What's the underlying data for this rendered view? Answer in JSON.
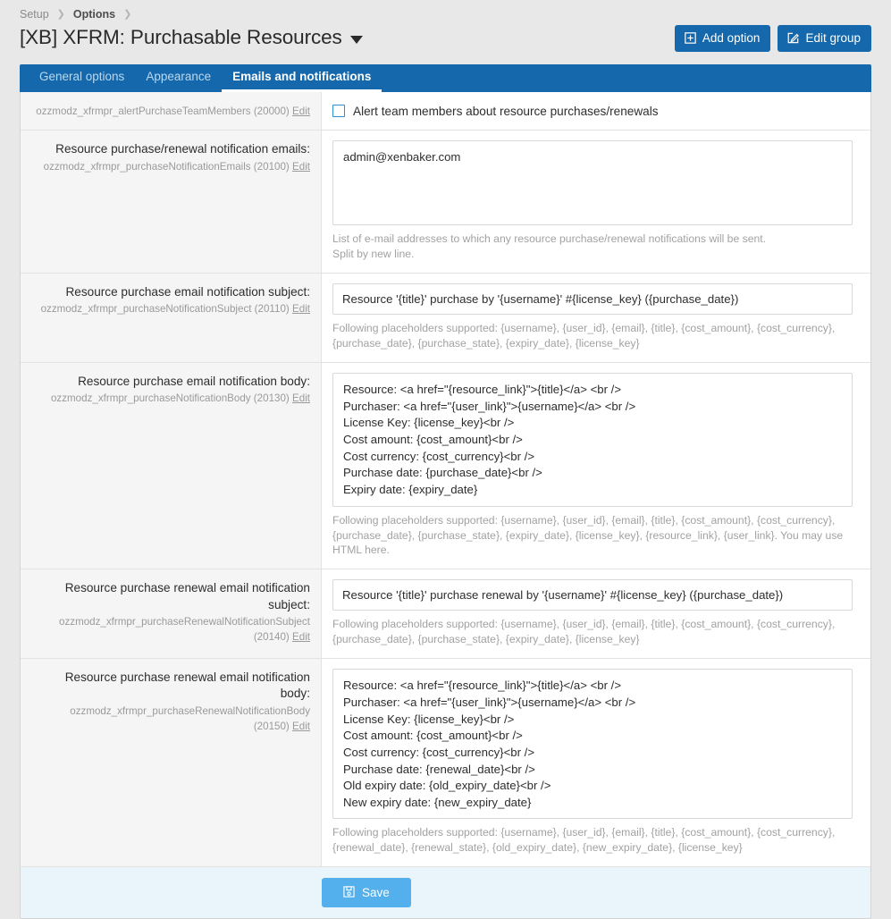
{
  "breadcrumb": [
    {
      "label": "Setup",
      "strong": false
    },
    {
      "label": "Options",
      "strong": true
    }
  ],
  "header": {
    "title": "[XB] XFRM: Purchasable Resources",
    "caret_icon": "chevron-down-icon",
    "buttons": [
      {
        "label": "Add option",
        "icon": "plus-box-icon"
      },
      {
        "label": "Edit group",
        "icon": "pencil-square-icon"
      }
    ]
  },
  "tabs": [
    {
      "label": "General options",
      "active": false
    },
    {
      "label": "Appearance",
      "active": false
    },
    {
      "label": "Emails and notifications",
      "active": true
    }
  ],
  "rows": {
    "alert_team": {
      "option_id": "ozzmodz_xfrmpr_alertPurchaseTeamMembers (20000)",
      "edit_label": "Edit",
      "checkbox_label": "Alert team members about resource purchases/renewals",
      "checked": false
    },
    "notification_emails": {
      "label": "Resource purchase/renewal notification emails:",
      "option_id": "ozzmodz_xfrmpr_purchaseNotificationEmails (20100)",
      "edit_label": "Edit",
      "value": "admin@xenbaker.com",
      "hint": "List of e-mail addresses to which any resource purchase/renewal notifications will be sent.\nSplit by new line."
    },
    "purchase_subject": {
      "label": "Resource purchase email notification subject:",
      "option_id": "ozzmodz_xfrmpr_purchaseNotificationSubject (20110)",
      "edit_label": "Edit",
      "value": "Resource '{title}' purchase by '{username}' #{license_key} ({purchase_date})",
      "hint": "Following placeholders supported: {username}, {user_id}, {email}, {title}, {cost_amount}, {cost_currency}, {purchase_date}, {purchase_state}, {expiry_date}, {license_key}"
    },
    "purchase_body": {
      "label": "Resource purchase email notification body:",
      "option_id": "ozzmodz_xfrmpr_purchaseNotificationBody (20130)",
      "edit_label": "Edit",
      "value": "Resource: <a href=\"{resource_link}\">{title}</a> <br />\nPurchaser: <a href=\"{user_link}\">{username}</a> <br />\nLicense Key: {license_key}<br />\nCost amount: {cost_amount}<br />\nCost currency: {cost_currency}<br />\nPurchase date: {purchase_date}<br />\nExpiry date: {expiry_date}",
      "hint": "Following placeholders supported: {username}, {user_id}, {email}, {title}, {cost_amount}, {cost_currency}, {purchase_date}, {purchase_state}, {expiry_date}, {license_key}, {resource_link}, {user_link}. You may use HTML here."
    },
    "renewal_subject": {
      "label": "Resource purchase renewal email notification subject:",
      "option_id": "ozzmodz_xfrmpr_purchaseRenewalNotificationSubject (20140)",
      "edit_label": "Edit",
      "value": "Resource '{title}' purchase renewal by '{username}' #{license_key} ({purchase_date})",
      "hint": "Following placeholders supported: {username}, {user_id}, {email}, {title}, {cost_amount}, {cost_currency}, {purchase_date}, {purchase_state}, {expiry_date}, {license_key}"
    },
    "renewal_body": {
      "label": "Resource purchase renewal email notification body:",
      "option_id": "ozzmodz_xfrmpr_purchaseRenewalNotificationBody (20150)",
      "edit_label": "Edit",
      "value": "Resource: <a href=\"{resource_link}\">{title}</a> <br />\nPurchaser: <a href=\"{user_link}\">{username}</a> <br />\nLicense Key: {license_key}<br />\nCost amount: {cost_amount}<br />\nCost currency: {cost_currency}<br />\nPurchase date: {renewal_date}<br />\nOld expiry date: {old_expiry_date}<br />\nNew expiry date: {new_expiry_date}",
      "hint": "Following placeholders supported: {username}, {user_id}, {email}, {title}, {cost_amount}, {cost_currency}, {renewal_date}, {renewal_state}, {old_expiry_date}, {new_expiry_date}, {license_key}"
    }
  },
  "footer": {
    "save_label": "Save",
    "save_icon": "floppy-disk-icon"
  },
  "colors": {
    "brand_blue": "#1568ab",
    "save_blue": "#53b0ec",
    "footer_bg": "#eaf4fb",
    "label_bg": "#f5f5f5"
  }
}
